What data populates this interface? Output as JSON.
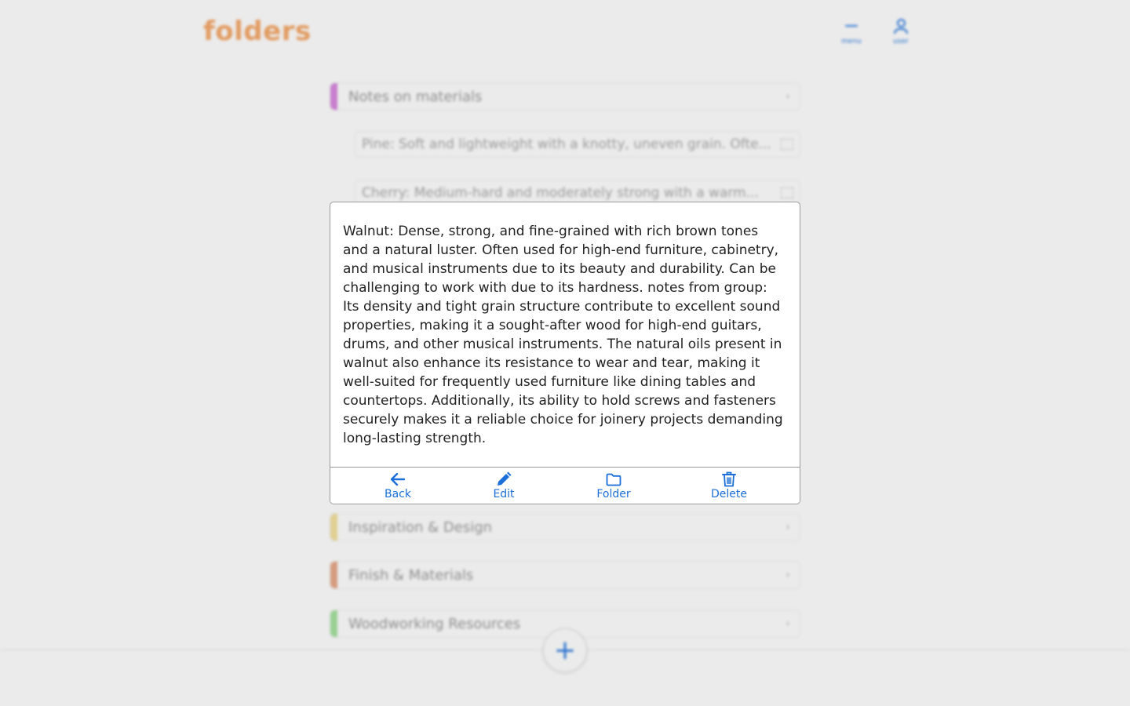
{
  "app": {
    "logo": "folders",
    "header": {
      "menu_label": "menu",
      "user_label": "user"
    }
  },
  "folders": [
    {
      "label": "Notes on materials",
      "accent": "#d98ae0"
    },
    {
      "label": "Inspiration & Design",
      "accent": "#f4e2a0"
    },
    {
      "label": "Finish & Materials",
      "accent": "#e8a98a"
    },
    {
      "label": "Woodworking Resources",
      "accent": "#a6e3a0"
    }
  ],
  "notes": [
    {
      "label": "Pine: Soft and lightweight with a knotty, uneven grain. Ofte..."
    },
    {
      "label": "Cherry: Medium-hard and moderately strong with a warm..."
    }
  ],
  "fab_label": "+",
  "modal": {
    "text": "Walnut: Dense, strong, and fine-grained with rich brown tones and a natural luster. Often used for high-end furniture, cabinetry, and musical instruments due to its beauty and durability. Can be challenging to work with due to its hardness. notes from group: Its density and tight grain structure contribute to excellent sound properties, making it a sought-after wood for high-end guitars, drums, and other musical instruments. The natural oils present in walnut also enhance its resistance to wear and tear, making it well-suited for frequently used furniture like dining tables and countertops. Additionally, its ability to hold screws and fasteners securely makes it a reliable choice for joinery projects demanding long-lasting strength.",
    "actions": {
      "back": "Back",
      "edit": "Edit",
      "folder": "Folder",
      "delete": "Delete"
    }
  },
  "colors": {
    "accent_blue": "#1a6fd8",
    "logo_orange": "#f6a96a"
  },
  "icons": {
    "back": "arrow-left-icon",
    "edit": "pencil-icon",
    "folder": "folder-icon",
    "delete": "trash-icon",
    "menu": "menu-icon",
    "user": "user-icon",
    "add": "plus-icon"
  }
}
